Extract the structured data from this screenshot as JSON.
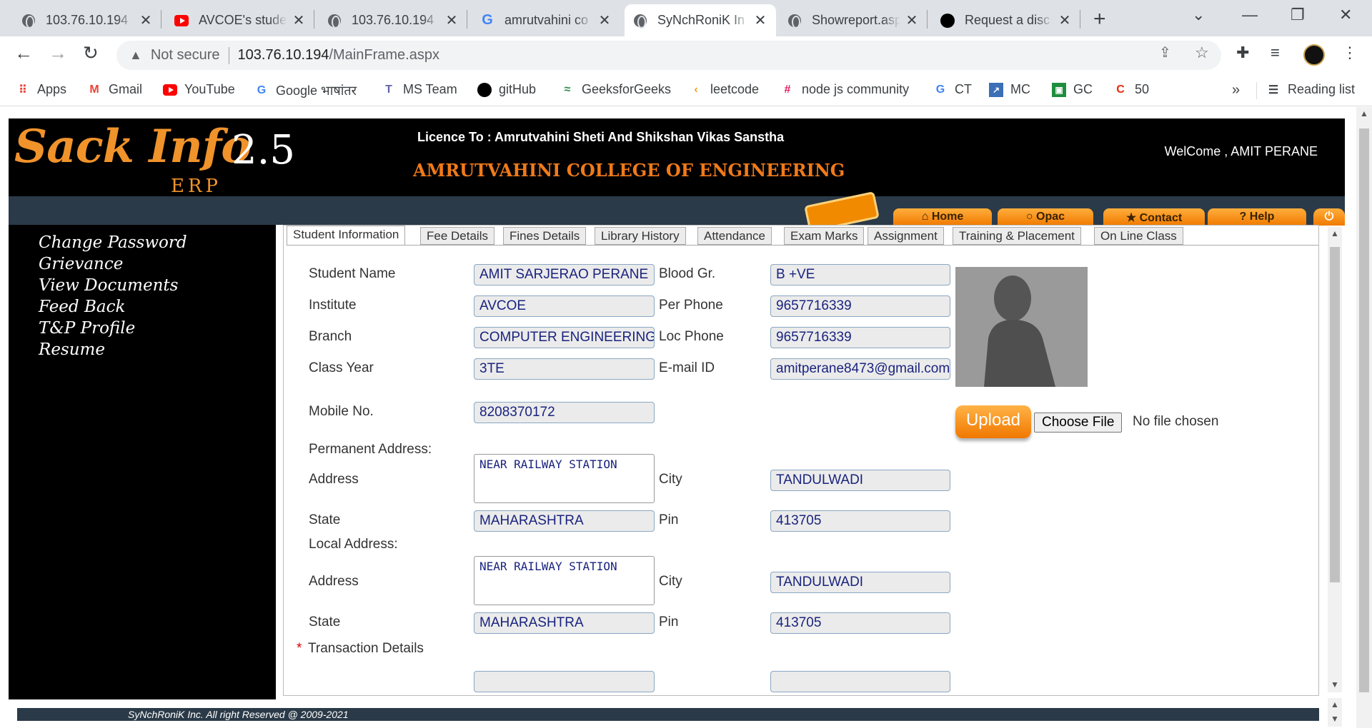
{
  "browser": {
    "tabs": [
      {
        "title": "103.76.10.194",
        "icon": "globe-icon"
      },
      {
        "title": "AVCOE's studen",
        "icon": "youtube-icon"
      },
      {
        "title": "103.76.10.194",
        "icon": "globe-icon"
      },
      {
        "title": "amrutvahini co",
        "icon": "google-icon"
      },
      {
        "title": "SyNchRoniK In",
        "icon": "globe-icon"
      },
      {
        "title": "Showreport.asp",
        "icon": "globe-icon"
      },
      {
        "title": "Request a disc",
        "icon": "github-icon"
      }
    ],
    "active_tab_index": 4,
    "address": {
      "security": "Not secure",
      "host": "103.76.10.194",
      "path": "/MainFrame.aspx"
    },
    "bookmarks": [
      {
        "label": "Apps",
        "icon": "apps-icon"
      },
      {
        "label": "Gmail",
        "icon": "gmail-icon"
      },
      {
        "label": "YouTube",
        "icon": "youtube-icon"
      },
      {
        "label": "Google भाषांतर",
        "icon": "translate-icon"
      },
      {
        "label": "MS Team",
        "icon": "teams-icon"
      },
      {
        "label": "gitHub",
        "icon": "github-icon"
      },
      {
        "label": "GeeksforGeeks",
        "icon": "gfg-icon"
      },
      {
        "label": "leetcode",
        "icon": "leetcode-icon"
      },
      {
        "label": "node js community",
        "icon": "slack-icon"
      },
      {
        "label": "CT",
        "icon": "google-icon"
      },
      {
        "label": "MC",
        "icon": "mc-icon"
      },
      {
        "label": "GC",
        "icon": "classroom-icon"
      },
      {
        "label": "50",
        "icon": "c-icon"
      }
    ],
    "more": "»",
    "reading_list": "Reading list"
  },
  "header": {
    "logo_main": "Sack Info",
    "logo_version": "2.5",
    "logo_sub": "ERP",
    "licence": "Licence To : Amrutvahini Sheti And Shikshan Vikas Sanstha",
    "college": "AMRUTVAHINI COLLEGE OF ENGINEERING",
    "welcome": "WelCome , AMIT PERANE",
    "nav_buttons": [
      "Home",
      "Opac",
      "Contact",
      "Help"
    ]
  },
  "sidebar": {
    "links": [
      "Change Password",
      "Grievance",
      "View Documents",
      "Feed Back",
      "T&P Profile",
      "Resume"
    ]
  },
  "content": {
    "tabs": [
      "Student Information",
      "Fee Details",
      "Fines Details",
      "Library History",
      "Attendance",
      "Exam Marks",
      "Assignment",
      "Training & Placement",
      "On Line Class"
    ],
    "selected_tab": "Student Information",
    "labels": {
      "student_name": "Student Name",
      "institute": "Institute",
      "branch": "Branch",
      "class_year": "Class Year",
      "mobile": "Mobile No.",
      "blood": "Blood Gr.",
      "per_phone": "Per Phone",
      "loc_phone": "Loc Phone",
      "email": "E-mail ID",
      "permanent_address": "Permanent Address:",
      "local_address": "Local Address:",
      "address": "Address",
      "city": "City",
      "state": "State",
      "pin": "Pin",
      "transaction": "Transaction Details",
      "required_mark": "*"
    },
    "values": {
      "student_name": "AMIT SARJERAO PERANE",
      "institute": "AVCOE",
      "branch": "COMPUTER ENGINEERING",
      "class_year": "3TE",
      "mobile": "8208370172",
      "blood": "B +VE",
      "per_phone": "9657716339",
      "loc_phone": "9657716339",
      "email": "amitperane8473@gmail.com",
      "perm_address": "NEAR RAILWAY STATION",
      "perm_city": "TANDULWADI",
      "perm_state": "MAHARASHTRA",
      "perm_pin": "413705",
      "local_address": "NEAR RAILWAY STATION",
      "local_city": "TANDULWADI",
      "local_state": "MAHARASHTRA",
      "local_pin": "413705"
    },
    "upload": {
      "button": "Upload",
      "choose": "Choose File",
      "status": "No file chosen"
    }
  },
  "footer": {
    "text": "SyNchRoniK Inc. All right Reserved @ 2009-2021"
  }
}
